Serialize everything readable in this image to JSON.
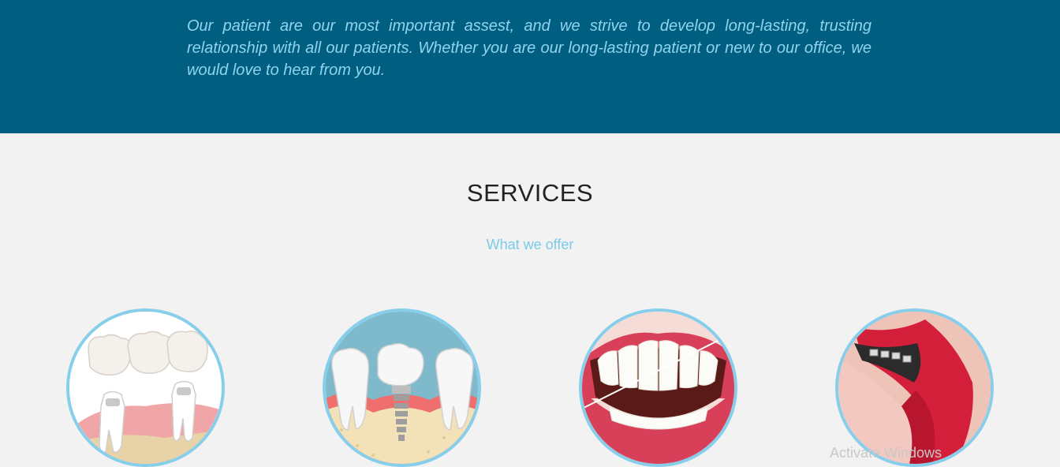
{
  "hero": {
    "text": "Our patient are our most important assest, and we strive to develop long-lasting, trusting relationship with all our patients. Whether you are our long-lasting patient or new to our office, we would love to hear from you."
  },
  "services": {
    "title": "SERVICES",
    "subtitle": "What we offer",
    "items": [
      {
        "icon": "dental-bridge-image"
      },
      {
        "icon": "dental-implant-image"
      },
      {
        "icon": "teeth-flossing-image"
      },
      {
        "icon": "dental-braces-lips-image"
      }
    ]
  },
  "os_watermark": {
    "text": "Activate Windows"
  },
  "colors": {
    "hero_bg": "#005f80",
    "hero_text": "#8fd3ee",
    "section_bg": "#f2f2f2",
    "circle_border": "#87ceeb",
    "subtitle": "#7ccbe8"
  }
}
